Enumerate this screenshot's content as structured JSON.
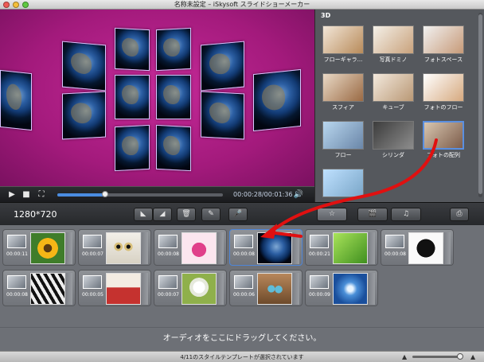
{
  "window": {
    "title": "名称未設定 – iSkysoft スライドショーメーカー"
  },
  "player": {
    "time": "00:00:28/00:01:36",
    "progress": 0.29,
    "play_icon": "play-icon",
    "stop_icon": "stop-icon",
    "fullscreen_icon": "fullscreen-icon",
    "volume_icon": "volume-icon"
  },
  "styles": {
    "category": "3D",
    "items": [
      {
        "label": "フローギャラ..."
      },
      {
        "label": "写真ドミノ"
      },
      {
        "label": "フォトスペース"
      },
      {
        "label": "スフィア"
      },
      {
        "label": "キューブ"
      },
      {
        "label": "フォトのフロー"
      },
      {
        "label": "フロー"
      },
      {
        "label": "シリンダ"
      },
      {
        "label": "フォトの配列",
        "selected": true
      },
      {
        "label": ""
      }
    ]
  },
  "toolbar": {
    "resolution": "1280*720",
    "buttons": [
      {
        "name": "flip-left-icon",
        "glyph": "◣"
      },
      {
        "name": "flip-right-icon",
        "glyph": "◢"
      },
      {
        "name": "trash-icon",
        "glyph": "🗑"
      },
      {
        "name": "edit-icon",
        "glyph": "✎"
      },
      {
        "name": "microphone-icon",
        "glyph": "🎤"
      },
      {
        "name": "style-icon",
        "glyph": "☆"
      },
      {
        "name": "media-icon",
        "glyph": "🎬"
      },
      {
        "name": "music-icon",
        "glyph": "♫"
      },
      {
        "name": "export-icon",
        "glyph": "⎙"
      }
    ]
  },
  "timeline": {
    "clips": [
      {
        "duration": "00:00:11",
        "subject": "sunflower"
      },
      {
        "duration": "00:00:07",
        "subject": "owl"
      },
      {
        "duration": "00:00:08",
        "subject": "lips"
      },
      {
        "duration": "00:00:08",
        "subject": "earth",
        "selected": true
      },
      {
        "duration": "00:00:21",
        "subject": "leaf"
      },
      {
        "duration": "00:00:08",
        "subject": "yin-yang"
      },
      {
        "duration": "00:00:08",
        "subject": "zebra"
      },
      {
        "duration": "00:00:05",
        "subject": "drum"
      },
      {
        "duration": "00:00:07",
        "subject": "dandelion"
      },
      {
        "duration": "00:00:06",
        "subject": "eggs"
      },
      {
        "duration": "00:00:09",
        "subject": "snowflake"
      }
    ]
  },
  "audio": {
    "hint": "オーディオをここにドラッグしてください。"
  },
  "status": {
    "text": "4/11のスタイルテンプレートが選択されています",
    "zoom": 0.95
  },
  "colors": {
    "accent": "#4a8ce0",
    "arrow": "#e01010",
    "preview_bg": "#b0208a"
  }
}
